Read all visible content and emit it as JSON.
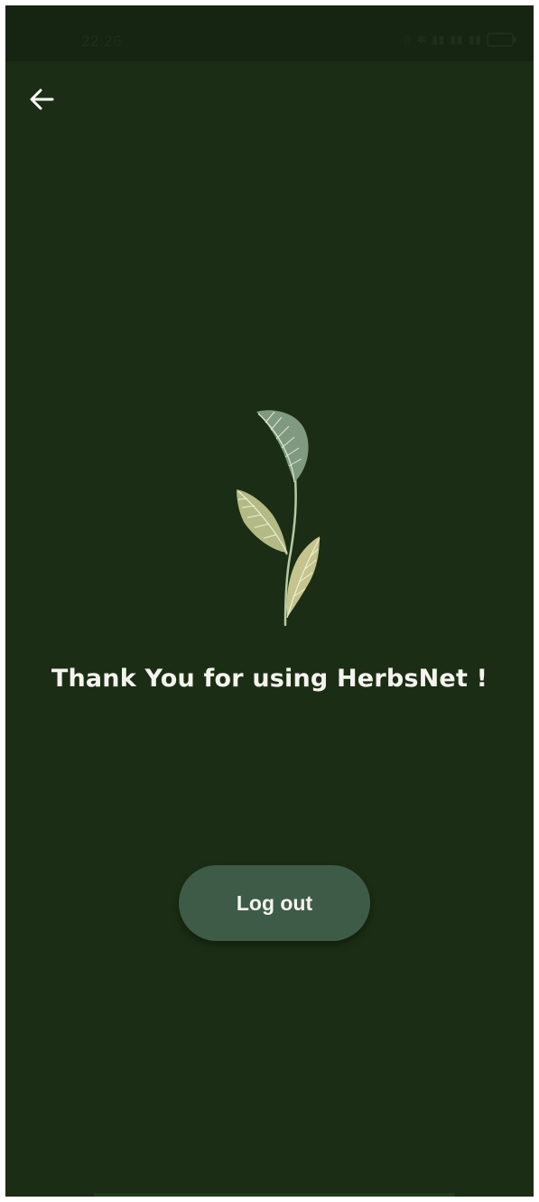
{
  "status_bar": {
    "time": "22:26",
    "icons": [
      "vibrate-icon",
      "bluetooth-icon",
      "signal-icon",
      "signal-icon",
      "wifi-icon",
      "battery-icon"
    ],
    "signal_text_1": "ᵢₗₗ",
    "signal_text_2": "ₗₗ"
  },
  "header": {
    "back_icon": "arrow-left-icon"
  },
  "main": {
    "illustration": "plant-leaves",
    "message": "Thank You for using HerbsNet !",
    "logout_label": "Log out"
  },
  "colors": {
    "background": "#1b2d14",
    "button": "#3e5b47",
    "text": "#f4f4ef"
  }
}
